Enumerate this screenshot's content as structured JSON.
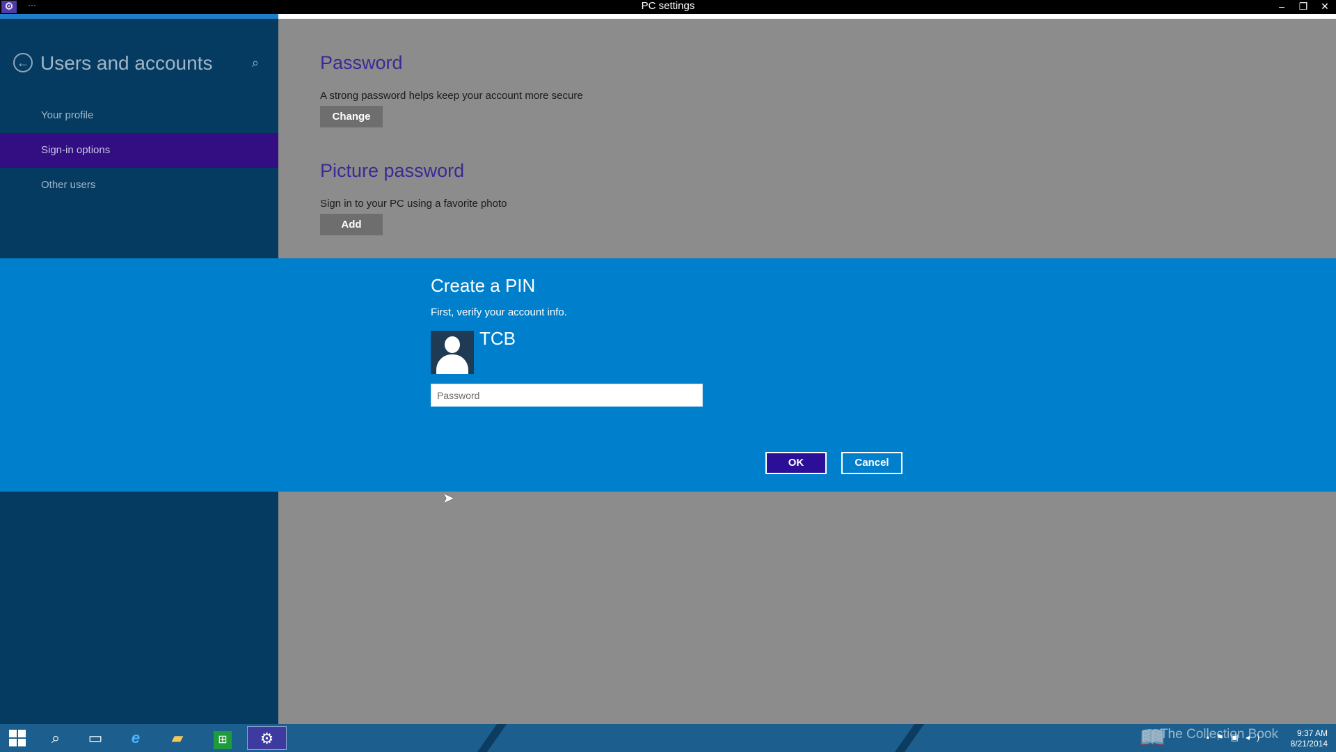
{
  "window": {
    "title": "PC settings",
    "app_icon": "gear-icon",
    "menu_dots": "···",
    "controls": {
      "minimize": "–",
      "restore": "❐",
      "close": "✕"
    }
  },
  "sidebar": {
    "title": "Users and accounts",
    "back_icon": "back-arrow-icon",
    "search_icon": "search-icon",
    "items": [
      {
        "label": "Your profile",
        "selected": false
      },
      {
        "label": "Sign-in options",
        "selected": true
      },
      {
        "label": "Other users",
        "selected": false
      }
    ]
  },
  "main": {
    "password": {
      "title": "Password",
      "desc": "A strong password helps keep your account more secure",
      "button": "Change"
    },
    "picture_password": {
      "title": "Picture password",
      "desc": "Sign in to your PC using a favorite photo",
      "button": "Add"
    }
  },
  "dialog": {
    "title": "Create a PIN",
    "subtitle": "First, verify your account info.",
    "user_name": "TCB",
    "avatar_icon": "user-avatar-icon",
    "password_placeholder": "Password",
    "password_value": "",
    "ok_label": "OK",
    "cancel_label": "Cancel"
  },
  "taskbar": {
    "items": [
      {
        "name": "start-button",
        "icon": "windows-logo-icon"
      },
      {
        "name": "search-button",
        "icon": "search-icon"
      },
      {
        "name": "task-view-button",
        "icon": "task-view-icon"
      },
      {
        "name": "internet-explorer-button",
        "icon": "ie-icon"
      },
      {
        "name": "file-explorer-button",
        "icon": "folder-icon"
      },
      {
        "name": "store-button",
        "icon": "store-icon"
      },
      {
        "name": "pc-settings-button",
        "icon": "gear-icon",
        "active": true
      }
    ],
    "watermark": "The Collection Book",
    "time": "9:37 AM",
    "date": "8/21/2014"
  },
  "colors": {
    "sidebar_bg": "#063b61",
    "main_bg": "#8c8c8c",
    "selected_item_bg": "#330e83",
    "dialog_bg": "#0080cc",
    "ok_button_bg": "#2b0f97",
    "section_title": "#3b2a96",
    "taskbar_bg": "#1c5f8e"
  }
}
